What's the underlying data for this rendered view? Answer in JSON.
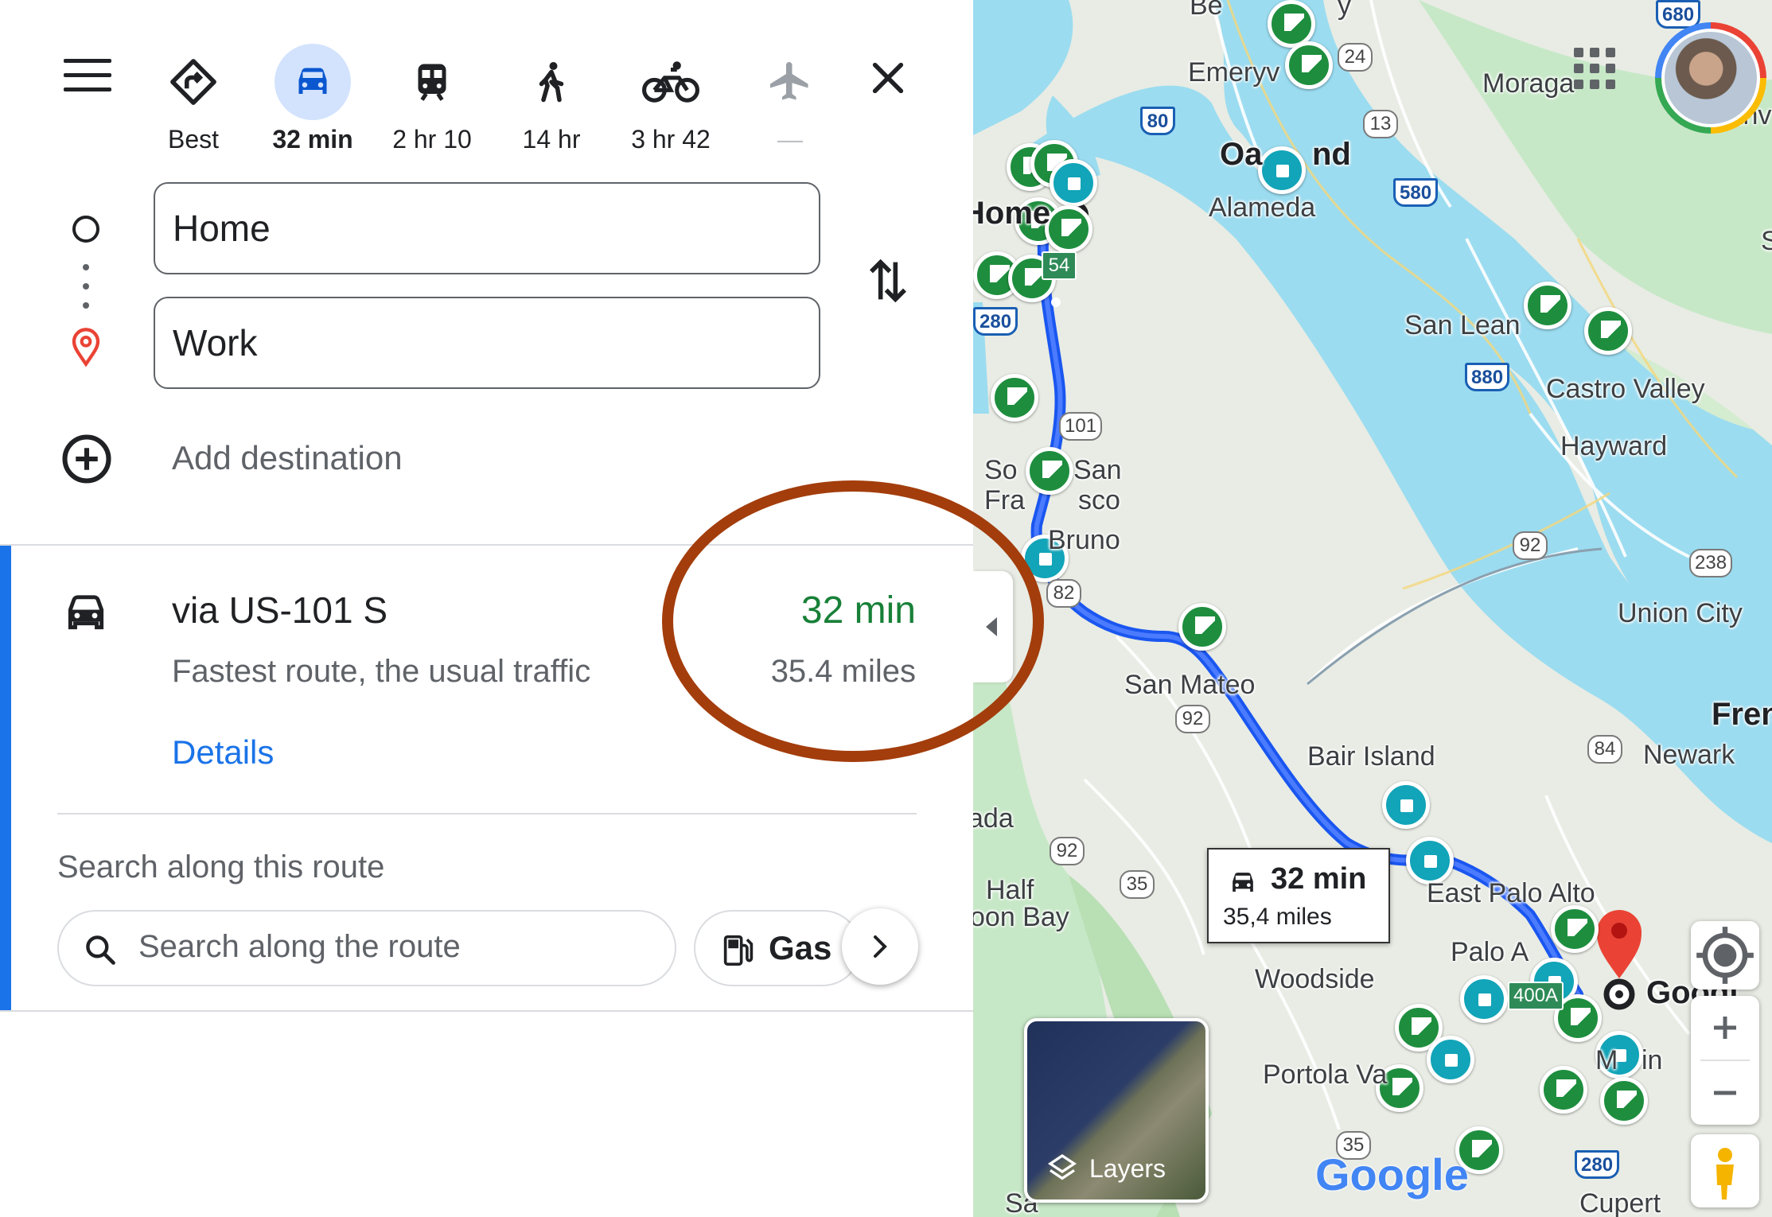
{
  "travel_modes": [
    {
      "name": "best",
      "label": "Best",
      "icon": "directions-icon",
      "active": false
    },
    {
      "name": "driving",
      "label": "32 min",
      "icon": "car-icon",
      "active": true
    },
    {
      "name": "transit",
      "label": "2 hr 10",
      "icon": "train-icon",
      "active": false
    },
    {
      "name": "walking",
      "label": "14 hr",
      "icon": "walking-icon",
      "active": false
    },
    {
      "name": "cycling",
      "label": "3 hr 42",
      "icon": "bicycle-icon",
      "active": false
    },
    {
      "name": "flight",
      "label": "—",
      "icon": "airplane-icon",
      "active": false
    }
  ],
  "origin": {
    "value": "Home"
  },
  "destination": {
    "value": "Work"
  },
  "add_destination_label": "Add destination",
  "route": {
    "title": "via US-101 S",
    "subtitle": "Fastest route, the usual traffic",
    "time": "32 min",
    "distance": "35.4 miles",
    "details_label": "Details"
  },
  "search_along": {
    "title": "Search along this route",
    "placeholder": "Search along the route",
    "chip_gas": "Gas"
  },
  "map": {
    "route_callout": {
      "time": "32 min",
      "distance": "35,4 miles"
    },
    "layers_label": "Layers",
    "labels": [
      "Emeryv",
      "Moraga",
      "Danv",
      "Oa",
      "nd",
      "Alameda",
      "Home",
      "San Lean",
      "Castro Valley",
      "Hayward",
      "So",
      "San",
      "Fra",
      "sco",
      "Bruno",
      "Union City",
      "San Mateo",
      "Fren",
      "Newark",
      "Bair Island",
      "ada",
      "Half",
      "oon Bay",
      "East Palo Alto",
      "Palo A",
      "Woodside",
      "Googl",
      "Portola Va",
      "Cupert",
      "Sa",
      "Be",
      "y",
      "S",
      "in",
      "M"
    ],
    "shields": [
      "24",
      "80",
      "13",
      "580",
      "54",
      "280",
      "880",
      "101",
      "92",
      "238",
      "82",
      "92",
      "84",
      "92",
      "35",
      "400A",
      "35",
      "280",
      "680"
    ],
    "brand": "Google",
    "colors": {
      "route": "#1a56f0",
      "water": "#9bdcf0",
      "land": "#e8ece4",
      "park": "#c7e8c7",
      "poi_green": "#1e8e3e",
      "poi_teal": "#12a4b8"
    }
  },
  "colors": {
    "accent": "#1a73e8",
    "time_green": "#188038",
    "annotation": "#a33d0c"
  }
}
